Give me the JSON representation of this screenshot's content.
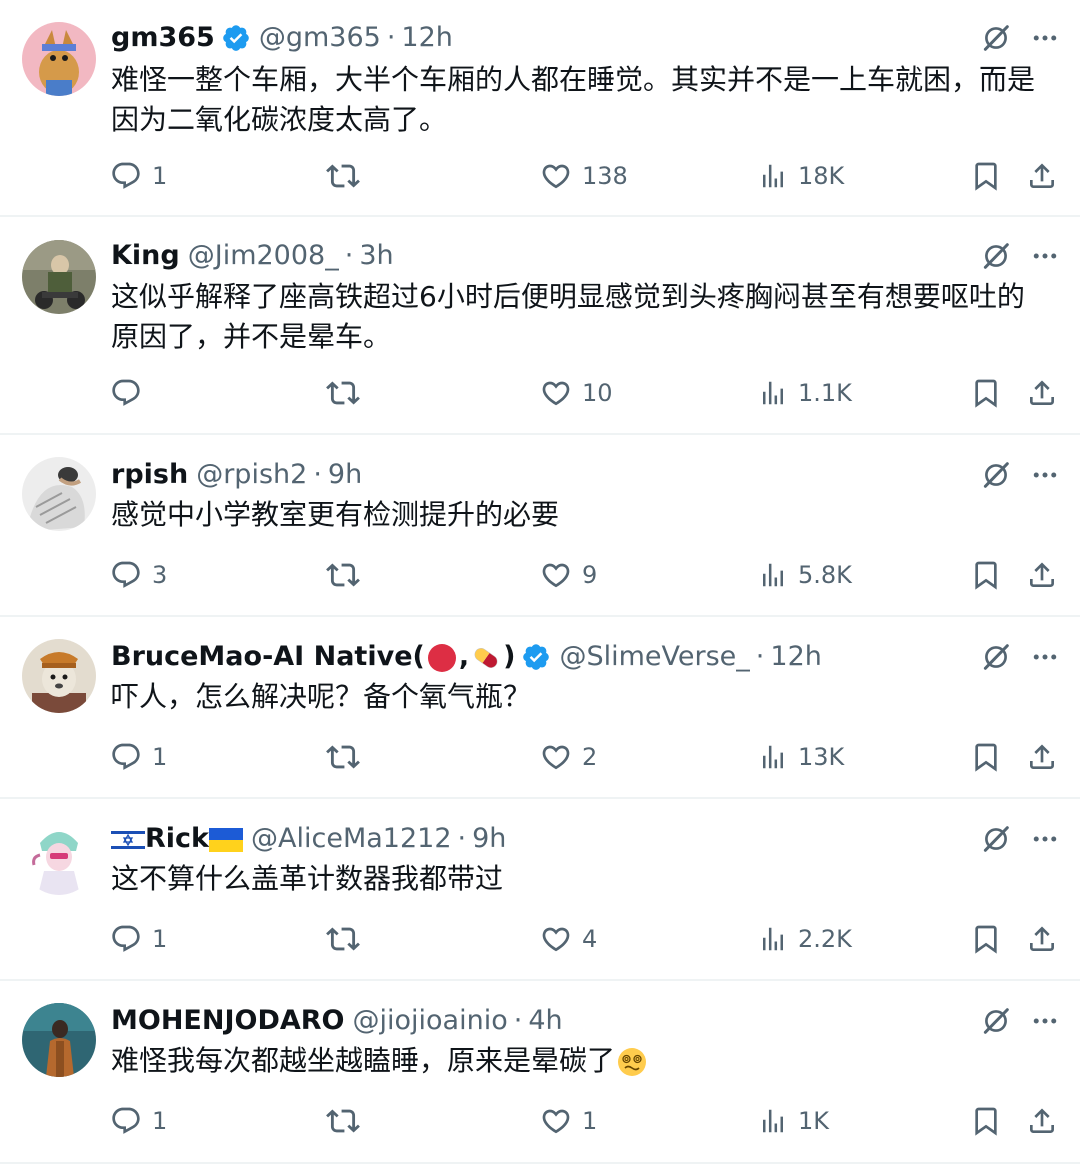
{
  "replies": [
    {
      "name": "gm365",
      "verified": true,
      "handle": "@gm365",
      "time": "12h",
      "text": "难怪一整个车厢，大半个车厢的人都在睡觉。其实并不是一上车就困，而是因为二氧化碳浓度太高了。",
      "replies_count": "1",
      "reposts_count": "",
      "likes_count": "138",
      "views_count": "18K"
    },
    {
      "name": "King",
      "verified": false,
      "handle": "@Jim2008_",
      "time": "3h",
      "text": "这似乎解释了座高铁超过6小时后便明显感觉到头疼胸闷甚至有想要呕吐的原因了，并不是晕车。",
      "replies_count": "",
      "reposts_count": "",
      "likes_count": "10",
      "views_count": "1.1K"
    },
    {
      "name": "rpish",
      "verified": false,
      "handle": "@rpish2",
      "time": "9h",
      "text": "感觉中小学教室更有检测提升的必要",
      "replies_count": "3",
      "reposts_count": "",
      "likes_count": "9",
      "views_count": "5.8K"
    },
    {
      "name_prefix": "BruceMao-AI Native(",
      "name_mid": ",",
      "name_suffix": ")",
      "verified": true,
      "handle": "@SlimeVerse_",
      "time": "12h",
      "text": "吓人，怎么解决呢？备个氧气瓶？",
      "replies_count": "1",
      "reposts_count": "",
      "likes_count": "2",
      "views_count": "13K"
    },
    {
      "name": "Rick",
      "verified": false,
      "handle": "@AliceMa1212",
      "time": "9h",
      "text": "这不算什么盖革计数器我都带过",
      "replies_count": "1",
      "reposts_count": "",
      "likes_count": "4",
      "views_count": "2.2K"
    },
    {
      "name": "MOHENJODARO",
      "verified": false,
      "handle": "@jiojioainio",
      "time": "4h",
      "text": "难怪我每次都越坐越瞌睡，原来是晕碳了",
      "replies_count": "1",
      "reposts_count": "",
      "likes_count": "1",
      "views_count": "1K"
    }
  ],
  "separator": "·",
  "colors": {
    "text": "#0f1419",
    "secondary": "#536471",
    "verified": "#1d9bf0",
    "divider": "#eff3f4"
  },
  "icons": {
    "reply": "speech-bubble-icon",
    "repost": "repost-arrows-icon",
    "like": "heart-icon",
    "views": "bar-chart-icon",
    "bookmark": "bookmark-icon",
    "share": "share-upload-icon",
    "grok": "grok-slash-circle-icon",
    "more": "more-dots-icon"
  }
}
